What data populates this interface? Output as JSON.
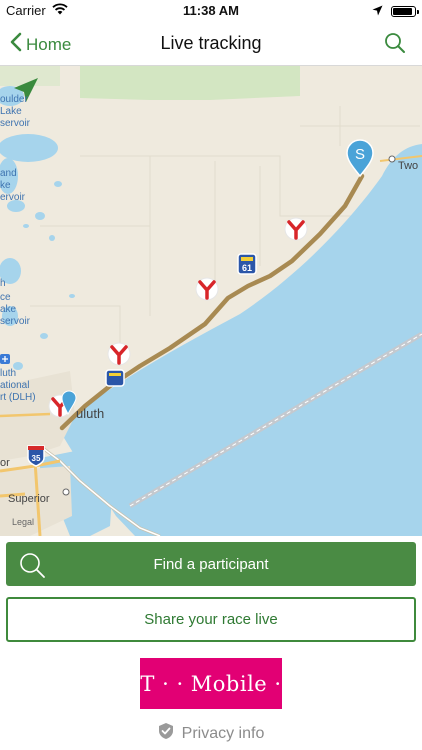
{
  "status_bar": {
    "carrier": "Carrier",
    "time": "11:38 AM",
    "battery_level": 0.9
  },
  "nav": {
    "back_label": "Home",
    "title": "Live tracking"
  },
  "map": {
    "labels": {
      "boulder_1": "oulder",
      "boulder_2": "Lake",
      "boulder_3": "servoir",
      "island_1": "and",
      "island_2": "ke",
      "island_3": "ervoir",
      "fish_1": "h",
      "fish_2": "ce",
      "fish_3": "ake",
      "fish_4": "servoir",
      "airport_1": "luth",
      "airport_2": "ational",
      "airport_3": "rt (DLH)",
      "duluth": "uluth",
      "superior": "Superior",
      "legal": "Legal",
      "or": "or",
      "two_harbors": "Two",
      "hwy_35": "35",
      "hwy_61": "61",
      "start_marker": "S"
    }
  },
  "actions": {
    "find_label": "Find a participant",
    "share_label": "Share your race live"
  },
  "sponsor": {
    "logo_text": "T · · Mobile ·"
  },
  "privacy": {
    "label": "Privacy info"
  },
  "colors": {
    "accent": "#4a8b44",
    "lake": "#a6d4ec",
    "route": "#a88a52",
    "sponsor": "#e20074"
  }
}
